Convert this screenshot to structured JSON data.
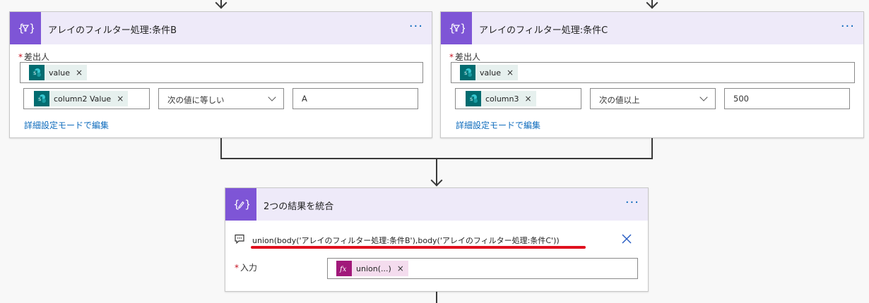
{
  "cards": {
    "filter_b": {
      "title": "アレイのフィルター処理:条件B",
      "from_label": "差出人",
      "from_token": "value",
      "left_token": "column2 Value",
      "operator": "次の値に等しい",
      "value": "A",
      "advanced_link": "詳細設定モードで編集"
    },
    "filter_c": {
      "title": "アレイのフィルター処理:条件C",
      "from_label": "差出人",
      "from_token": "value",
      "left_token": "column3",
      "operator": "次の値以上",
      "value": "500",
      "advanced_link": "詳細設定モードで編集"
    },
    "combine": {
      "title": "2つの結果を統合",
      "expression": "union(body('アレイのフィルター処理:条件B'),body('アレイのフィルター処理:条件C'))",
      "input_label": "入力",
      "input_token": "union(...)"
    }
  },
  "common": {
    "more_label": "···",
    "required_mark": "*",
    "remove_mark": "×"
  },
  "colors": {
    "action_accent": "#7e55d6",
    "header_bg": "#eeeaf9",
    "sharepoint_token": "#036c70",
    "expression_token": "#a1197a",
    "link": "#0f6cbd",
    "annotation_underline": "#e0101e"
  },
  "icons": {
    "filter_action": "filter-array-icon",
    "compose_action": "compose-icon",
    "sharepoint": "sharepoint-icon",
    "expression": "fx-icon",
    "comment": "comment-icon",
    "close": "close-icon"
  }
}
